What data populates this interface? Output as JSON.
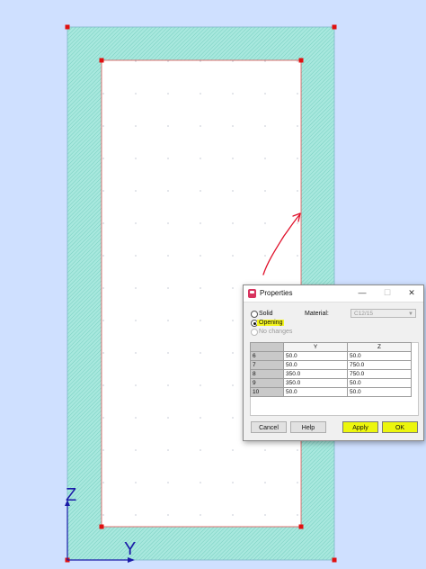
{
  "drawing": {
    "axis_z_label": "Z",
    "axis_y_label": "Y",
    "section_fill": "#a8e8de",
    "background": "#cfe0ff",
    "annotation_color": "#e0102a"
  },
  "dialog": {
    "title": "Properties",
    "window_buttons": {
      "minimize": "—",
      "maximize": "☐",
      "close": "✕"
    },
    "options": {
      "solid": "Solid",
      "opening": "Opening",
      "no_changes": "No changes"
    },
    "material_label": "Material:",
    "material_value": "C12/15",
    "table": {
      "headers": [
        "Y",
        "Z"
      ],
      "rows": [
        {
          "id": "6",
          "y": "50.0",
          "z": "50.0"
        },
        {
          "id": "7",
          "y": "50.0",
          "z": "750.0"
        },
        {
          "id": "8",
          "y": "350.0",
          "z": "750.0"
        },
        {
          "id": "9",
          "y": "350.0",
          "z": "50.0"
        },
        {
          "id": "10",
          "y": "50.0",
          "z": "50.0"
        }
      ]
    },
    "buttons": {
      "cancel": "Cancel",
      "help": "Help",
      "apply": "Apply",
      "ok": "OK"
    },
    "highlight_color": "#f4f51f"
  }
}
